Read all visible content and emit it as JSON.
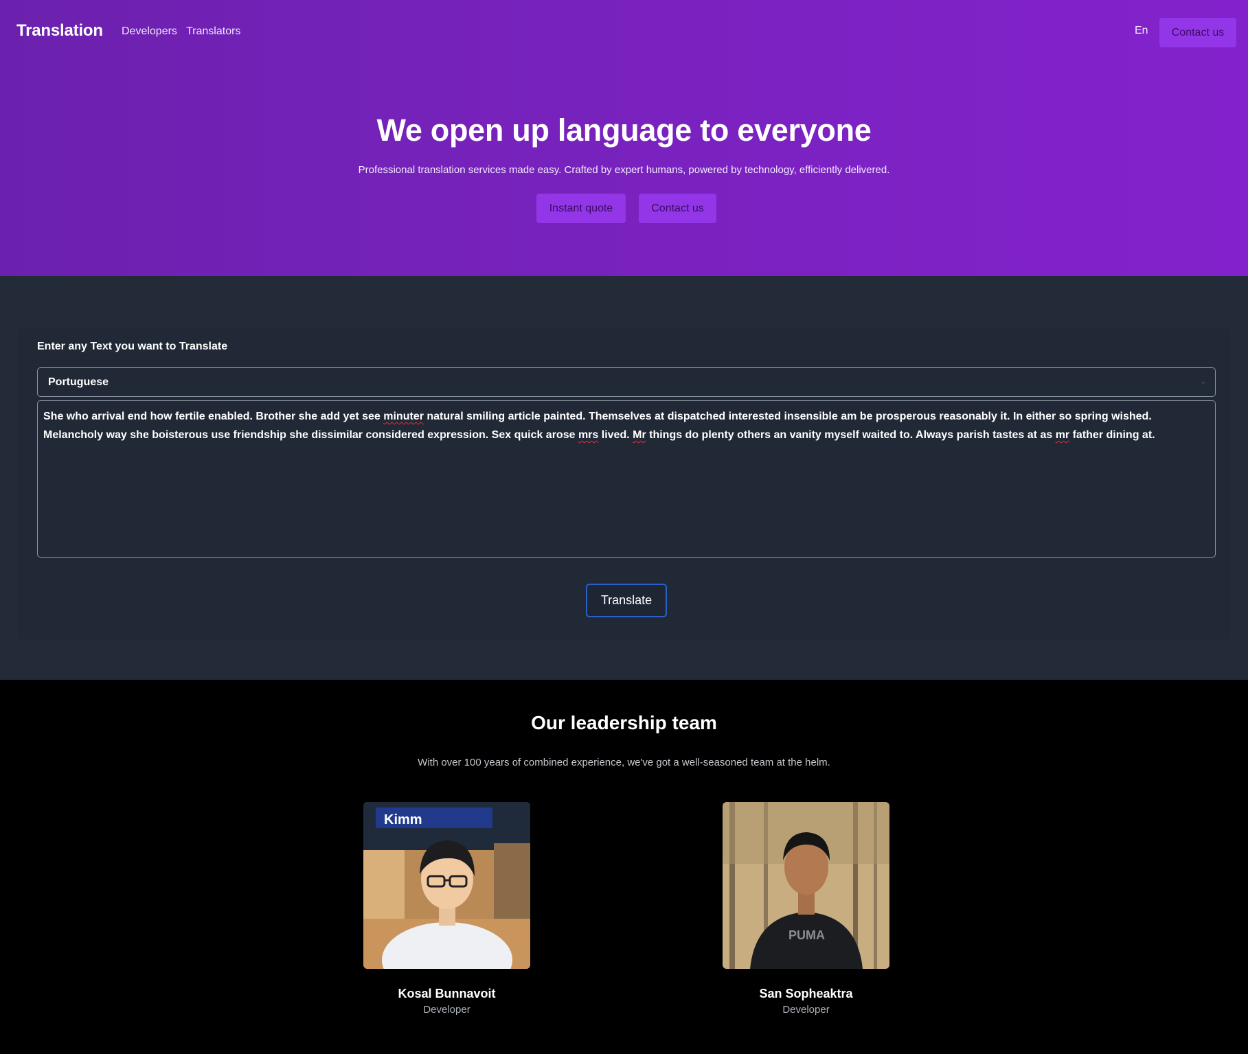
{
  "nav": {
    "brand": "Translation",
    "links": [
      {
        "label": "Developers"
      },
      {
        "label": "Translators"
      }
    ],
    "language": "En",
    "contact_label": "Contact us"
  },
  "hero": {
    "title": "We open up language to everyone",
    "subtitle": "Professional translation services made easy. Crafted by expert humans, powered by technology, efficiently delivered.",
    "quote_label": "Instant quote",
    "contact_label": "Contact us"
  },
  "translator": {
    "label": "Enter any Text you want to Translate",
    "selected_language": "Portuguese",
    "input_text": {
      "p1": "She who arrival end how fertile enabled. Brother she add yet see ",
      "w1": "minuter",
      "p2": " natural smiling article painted. Themselves at dispatched interested insensible am be prosperous reasonably it. In either so spring wished. Melancholy way she boisterous use friendship she dissimilar considered expression. Sex quick arose ",
      "w2": "mrs",
      "p3": " lived. ",
      "w3": "Mr",
      "p4": " things do plenty others an vanity myself waited to. Always parish tastes at as ",
      "w4": "mr",
      "p5": " father dining at."
    },
    "button_label": "Translate"
  },
  "team": {
    "title": "Our leadership team",
    "subtitle": "With over 100 years of combined experience, we've got a well-seasoned team at the helm.",
    "members": [
      {
        "name": "Kosal Bunnavoit",
        "role": "Developer",
        "photo_sign": "Kimm"
      },
      {
        "name": "San Sopheaktra",
        "role": "Developer",
        "shirt_logo": "PUMA"
      }
    ]
  },
  "colors": {
    "hero_start": "#6c21ae",
    "hero_end": "#8322cc",
    "accent_button": "#9236e8",
    "translator_bg": "#232b39",
    "translate_border": "#2c62c7",
    "team_bg": "#000000"
  }
}
